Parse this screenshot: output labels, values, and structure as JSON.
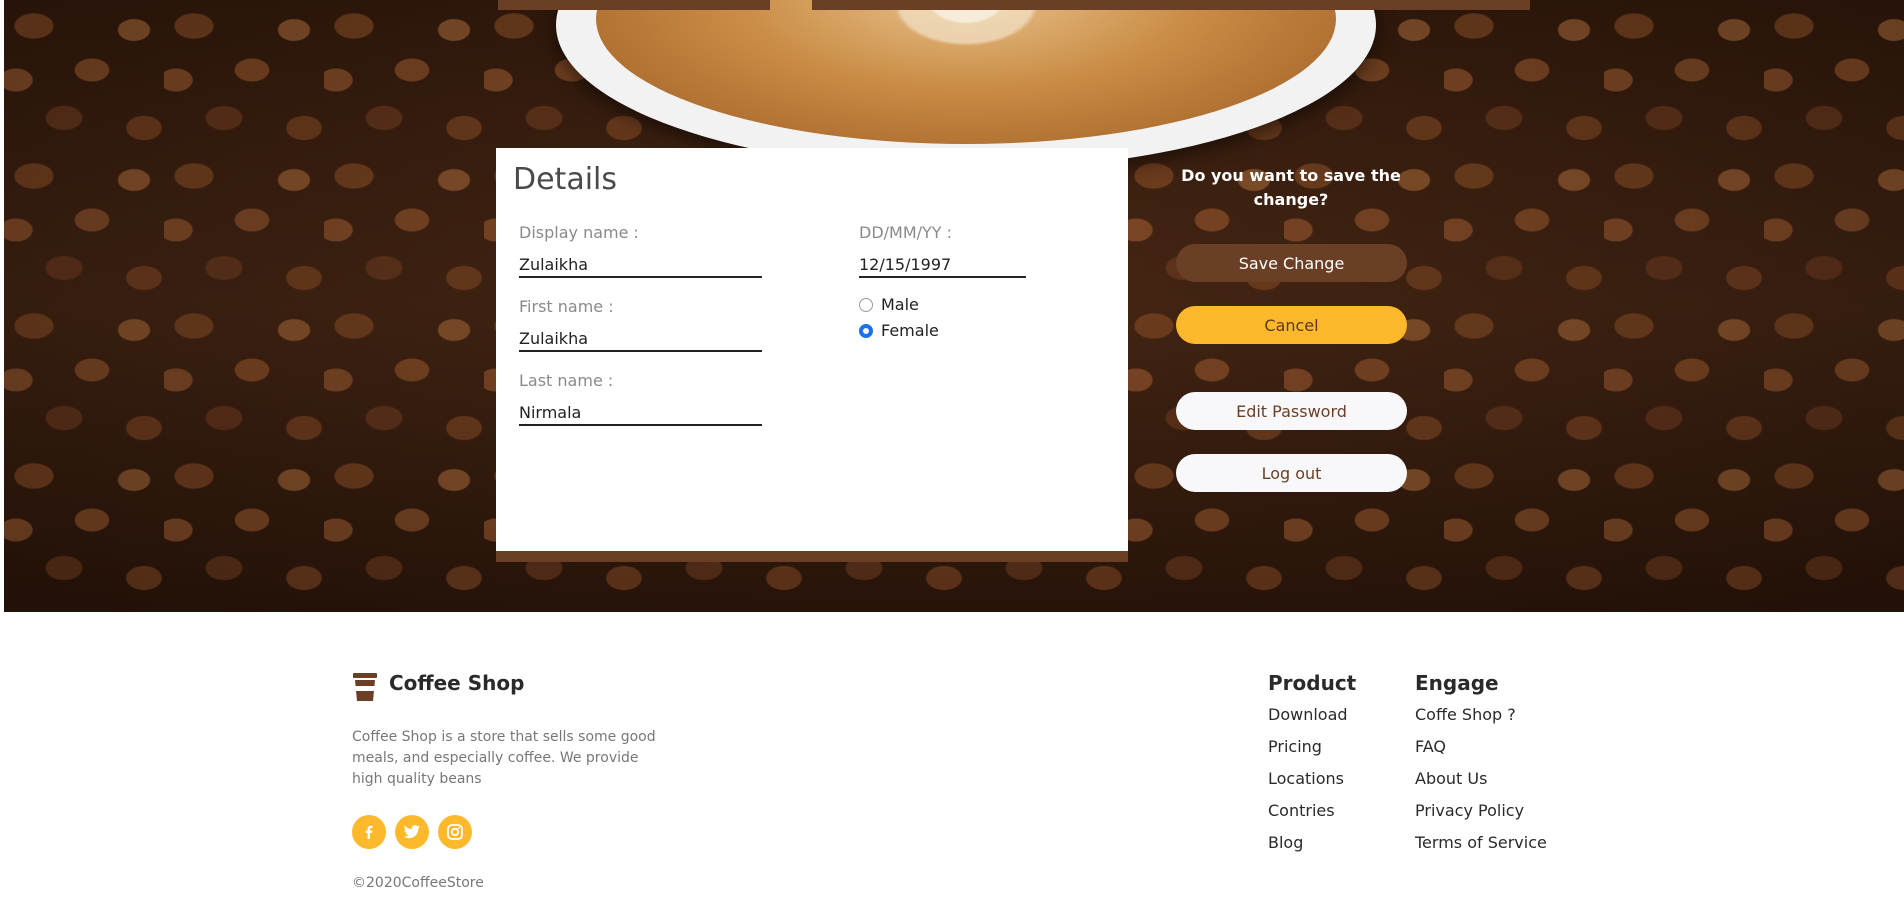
{
  "details": {
    "title": "Details",
    "display_name": {
      "label": "Display name :",
      "value": "Zulaikha"
    },
    "first_name": {
      "label": "First name :",
      "value": "Zulaikha"
    },
    "last_name": {
      "label": "Last name :",
      "value": "Nirmala"
    },
    "dob": {
      "label": "DD/MM/YY :",
      "value": "12/15/1997"
    },
    "gender": {
      "options": [
        "Male",
        "Female"
      ],
      "selected": "Female"
    }
  },
  "actions": {
    "question": "Do you want to save the change?",
    "save_label": "Save Change",
    "cancel_label": "Cancel",
    "edit_password_label": "Edit Password",
    "logout_label": "Log out"
  },
  "footer": {
    "brand": "Coffee Shop",
    "description": "Coffee Shop is a store that sells some good meals, and especially coffee. We provide high quality beans",
    "copyright": "©2020CoffeeStore",
    "social": [
      "facebook-icon",
      "twitter-icon",
      "instagram-icon"
    ],
    "product": {
      "title": "Product",
      "links": [
        "Download",
        "Pricing",
        "Locations",
        "Contries",
        "Blog"
      ]
    },
    "engage": {
      "title": "Engage",
      "links": [
        "Coffe Shop ?",
        "FAQ",
        "About Us",
        "Privacy Policy",
        "Terms of Service"
      ]
    }
  },
  "colors": {
    "brown": "#6b3f26",
    "accent_yellow": "#fdb82b",
    "radio_blue": "#1a73e8"
  }
}
